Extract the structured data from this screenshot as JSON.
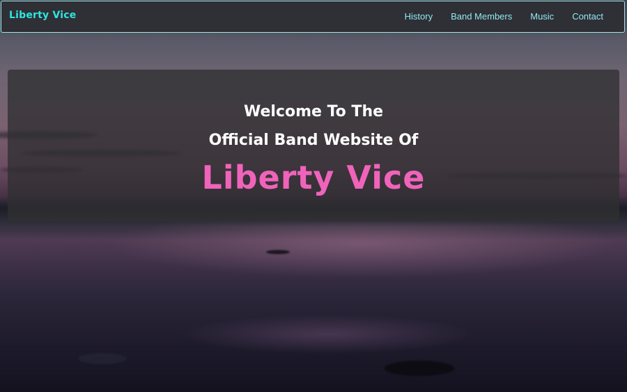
{
  "navbar": {
    "brand": "Liberty Vice",
    "links": [
      "History",
      "Band Members",
      "Music",
      "Contact"
    ]
  },
  "hero": {
    "line1": "Welcome To The",
    "line2": "Official Band Website Of",
    "title": "Liberty Vice"
  },
  "colors": {
    "brand": "#2ee6e0",
    "nav_link": "#8feaf0",
    "nav_border": "#9fe6e6",
    "title_pink": "#f063bb"
  }
}
